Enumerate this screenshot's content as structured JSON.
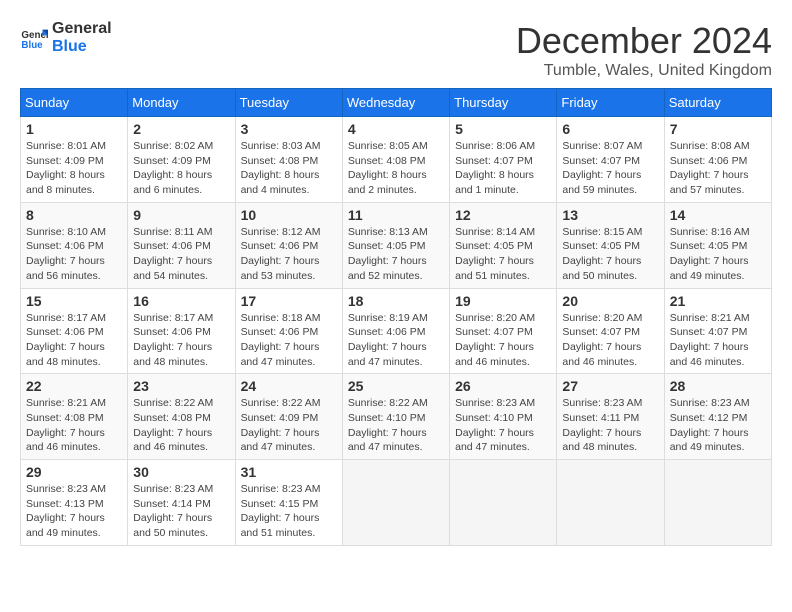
{
  "logo": {
    "line1": "General",
    "line2": "Blue"
  },
  "title": "December 2024",
  "location": "Tumble, Wales, United Kingdom",
  "days_of_week": [
    "Sunday",
    "Monday",
    "Tuesday",
    "Wednesday",
    "Thursday",
    "Friday",
    "Saturday"
  ],
  "weeks": [
    [
      {
        "day": "1",
        "sunrise": "Sunrise: 8:01 AM",
        "sunset": "Sunset: 4:09 PM",
        "daylight": "Daylight: 8 hours and 8 minutes."
      },
      {
        "day": "2",
        "sunrise": "Sunrise: 8:02 AM",
        "sunset": "Sunset: 4:09 PM",
        "daylight": "Daylight: 8 hours and 6 minutes."
      },
      {
        "day": "3",
        "sunrise": "Sunrise: 8:03 AM",
        "sunset": "Sunset: 4:08 PM",
        "daylight": "Daylight: 8 hours and 4 minutes."
      },
      {
        "day": "4",
        "sunrise": "Sunrise: 8:05 AM",
        "sunset": "Sunset: 4:08 PM",
        "daylight": "Daylight: 8 hours and 2 minutes."
      },
      {
        "day": "5",
        "sunrise": "Sunrise: 8:06 AM",
        "sunset": "Sunset: 4:07 PM",
        "daylight": "Daylight: 8 hours and 1 minute."
      },
      {
        "day": "6",
        "sunrise": "Sunrise: 8:07 AM",
        "sunset": "Sunset: 4:07 PM",
        "daylight": "Daylight: 7 hours and 59 minutes."
      },
      {
        "day": "7",
        "sunrise": "Sunrise: 8:08 AM",
        "sunset": "Sunset: 4:06 PM",
        "daylight": "Daylight: 7 hours and 57 minutes."
      }
    ],
    [
      {
        "day": "8",
        "sunrise": "Sunrise: 8:10 AM",
        "sunset": "Sunset: 4:06 PM",
        "daylight": "Daylight: 7 hours and 56 minutes."
      },
      {
        "day": "9",
        "sunrise": "Sunrise: 8:11 AM",
        "sunset": "Sunset: 4:06 PM",
        "daylight": "Daylight: 7 hours and 54 minutes."
      },
      {
        "day": "10",
        "sunrise": "Sunrise: 8:12 AM",
        "sunset": "Sunset: 4:06 PM",
        "daylight": "Daylight: 7 hours and 53 minutes."
      },
      {
        "day": "11",
        "sunrise": "Sunrise: 8:13 AM",
        "sunset": "Sunset: 4:05 PM",
        "daylight": "Daylight: 7 hours and 52 minutes."
      },
      {
        "day": "12",
        "sunrise": "Sunrise: 8:14 AM",
        "sunset": "Sunset: 4:05 PM",
        "daylight": "Daylight: 7 hours and 51 minutes."
      },
      {
        "day": "13",
        "sunrise": "Sunrise: 8:15 AM",
        "sunset": "Sunset: 4:05 PM",
        "daylight": "Daylight: 7 hours and 50 minutes."
      },
      {
        "day": "14",
        "sunrise": "Sunrise: 8:16 AM",
        "sunset": "Sunset: 4:05 PM",
        "daylight": "Daylight: 7 hours and 49 minutes."
      }
    ],
    [
      {
        "day": "15",
        "sunrise": "Sunrise: 8:17 AM",
        "sunset": "Sunset: 4:06 PM",
        "daylight": "Daylight: 7 hours and 48 minutes."
      },
      {
        "day": "16",
        "sunrise": "Sunrise: 8:17 AM",
        "sunset": "Sunset: 4:06 PM",
        "daylight": "Daylight: 7 hours and 48 minutes."
      },
      {
        "day": "17",
        "sunrise": "Sunrise: 8:18 AM",
        "sunset": "Sunset: 4:06 PM",
        "daylight": "Daylight: 7 hours and 47 minutes."
      },
      {
        "day": "18",
        "sunrise": "Sunrise: 8:19 AM",
        "sunset": "Sunset: 4:06 PM",
        "daylight": "Daylight: 7 hours and 47 minutes."
      },
      {
        "day": "19",
        "sunrise": "Sunrise: 8:20 AM",
        "sunset": "Sunset: 4:07 PM",
        "daylight": "Daylight: 7 hours and 46 minutes."
      },
      {
        "day": "20",
        "sunrise": "Sunrise: 8:20 AM",
        "sunset": "Sunset: 4:07 PM",
        "daylight": "Daylight: 7 hours and 46 minutes."
      },
      {
        "day": "21",
        "sunrise": "Sunrise: 8:21 AM",
        "sunset": "Sunset: 4:07 PM",
        "daylight": "Daylight: 7 hours and 46 minutes."
      }
    ],
    [
      {
        "day": "22",
        "sunrise": "Sunrise: 8:21 AM",
        "sunset": "Sunset: 4:08 PM",
        "daylight": "Daylight: 7 hours and 46 minutes."
      },
      {
        "day": "23",
        "sunrise": "Sunrise: 8:22 AM",
        "sunset": "Sunset: 4:08 PM",
        "daylight": "Daylight: 7 hours and 46 minutes."
      },
      {
        "day": "24",
        "sunrise": "Sunrise: 8:22 AM",
        "sunset": "Sunset: 4:09 PM",
        "daylight": "Daylight: 7 hours and 47 minutes."
      },
      {
        "day": "25",
        "sunrise": "Sunrise: 8:22 AM",
        "sunset": "Sunset: 4:10 PM",
        "daylight": "Daylight: 7 hours and 47 minutes."
      },
      {
        "day": "26",
        "sunrise": "Sunrise: 8:23 AM",
        "sunset": "Sunset: 4:10 PM",
        "daylight": "Daylight: 7 hours and 47 minutes."
      },
      {
        "day": "27",
        "sunrise": "Sunrise: 8:23 AM",
        "sunset": "Sunset: 4:11 PM",
        "daylight": "Daylight: 7 hours and 48 minutes."
      },
      {
        "day": "28",
        "sunrise": "Sunrise: 8:23 AM",
        "sunset": "Sunset: 4:12 PM",
        "daylight": "Daylight: 7 hours and 49 minutes."
      }
    ],
    [
      {
        "day": "29",
        "sunrise": "Sunrise: 8:23 AM",
        "sunset": "Sunset: 4:13 PM",
        "daylight": "Daylight: 7 hours and 49 minutes."
      },
      {
        "day": "30",
        "sunrise": "Sunrise: 8:23 AM",
        "sunset": "Sunset: 4:14 PM",
        "daylight": "Daylight: 7 hours and 50 minutes."
      },
      {
        "day": "31",
        "sunrise": "Sunrise: 8:23 AM",
        "sunset": "Sunset: 4:15 PM",
        "daylight": "Daylight: 7 hours and 51 minutes."
      },
      null,
      null,
      null,
      null
    ]
  ]
}
